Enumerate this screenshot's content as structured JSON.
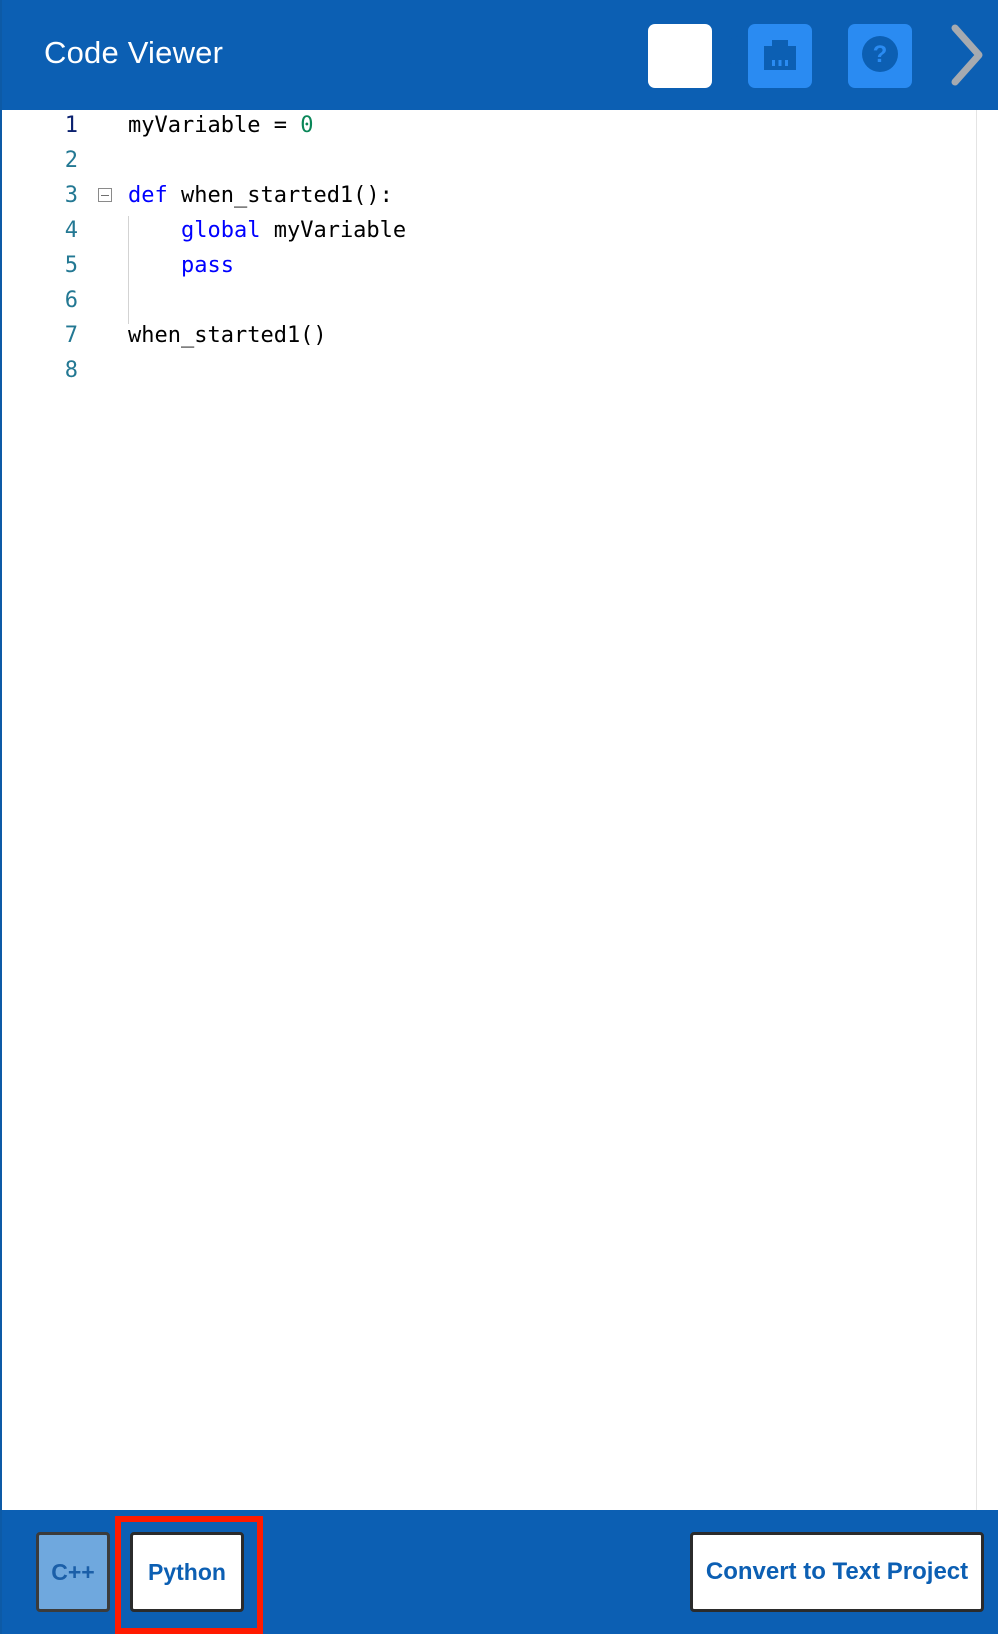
{
  "header": {
    "title": "Code Viewer",
    "buttons": [
      {
        "icon": "code-brackets-icon"
      },
      {
        "icon": "device-icon"
      },
      {
        "icon": "help-icon"
      }
    ],
    "collapse_icon": "chevron-right-icon"
  },
  "editor": {
    "lines": [
      {
        "number": "1",
        "tokens": [
          {
            "t": "myVariable = ",
            "k": "plain"
          },
          {
            "t": "0",
            "k": "num"
          }
        ]
      },
      {
        "number": "2",
        "tokens": []
      },
      {
        "number": "3",
        "tokens": [
          {
            "t": "def",
            "k": "kw"
          },
          {
            "t": " when_started1():",
            "k": "plain"
          }
        ],
        "foldable": true
      },
      {
        "number": "4",
        "tokens": [
          {
            "t": "    ",
            "k": "plain"
          },
          {
            "t": "global",
            "k": "kw"
          },
          {
            "t": " myVariable",
            "k": "plain"
          }
        ]
      },
      {
        "number": "5",
        "tokens": [
          {
            "t": "    ",
            "k": "plain"
          },
          {
            "t": "pass",
            "k": "kw"
          }
        ]
      },
      {
        "number": "6",
        "tokens": []
      },
      {
        "number": "7",
        "tokens": [
          {
            "t": "when_started1()",
            "k": "plain"
          }
        ]
      },
      {
        "number": "8",
        "tokens": []
      }
    ],
    "active_line": "1"
  },
  "footer": {
    "cpp_label": "C++",
    "python_label": "Python",
    "convert_label": "Convert to Text Project",
    "selected_language": "Python"
  },
  "colors": {
    "header_bg": "#0c5fb3",
    "keyword": "#0000ff",
    "number": "#098658",
    "line_number": "#237893",
    "highlight": "#ff1a00"
  }
}
